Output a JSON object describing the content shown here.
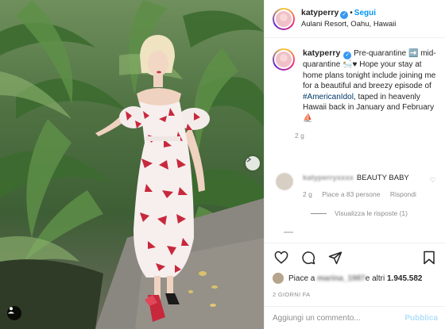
{
  "post": {
    "username": "katyperry",
    "verified_icon": "verified-badge-icon",
    "follow_label": "Segui",
    "separator": "•",
    "location": "Aulani Resort, Oahu, Hawaii"
  },
  "caption": {
    "username": "katyperry",
    "text_1": "Pre-quarantine ",
    "emoji_1": "➡️",
    "text_2": " mid-quarantine ",
    "emoji_2": "🛀🏼♥",
    "text_3": " Hope your stay at home plans tonight include joining me for a beautiful and breezy episode of ",
    "hashtag": "#AmericanIdol",
    "text_4": ", taped in heavenly Hawaii back in January and February ",
    "emoji_3": "⛵",
    "time": "2 g"
  },
  "comment": {
    "username": "katyperryxxxx",
    "text": "BEAUTY BABY",
    "time": "2 g",
    "likes": "Piace a 83 persone",
    "reply_label": "Rispondi",
    "view_replies": "Visualizza le risposte (1)"
  },
  "likes": {
    "prefix": "Piace a ",
    "liker": "marina_1987",
    "middle": " e altri ",
    "count": "1.945.582"
  },
  "date_label": "2 GIORNI FA",
  "add_comment": {
    "placeholder": "Aggiungi un commento...",
    "publish_label": "Pubblica"
  },
  "colors": {
    "accent": "#0095f6",
    "verified": "#3897f0",
    "hashtag": "#00376b",
    "muted": "#8e8e8e"
  }
}
